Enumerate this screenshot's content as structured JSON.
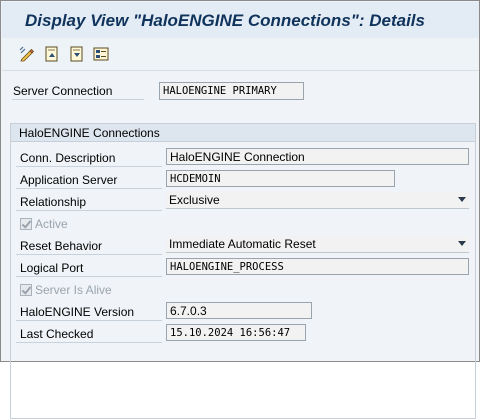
{
  "window": {
    "title": "Display View \"HaloENGINE Connections\": Details"
  },
  "toolbar": {
    "buttons": [
      {
        "icon": "display-change-icon"
      },
      {
        "icon": "previous-entry-icon"
      },
      {
        "icon": "next-entry-icon"
      },
      {
        "icon": "variable-list-icon"
      }
    ]
  },
  "server_connection": {
    "label": "Server Connection",
    "value": "HALOENGINE PRIMARY"
  },
  "group": {
    "title": "HaloENGINE Connections",
    "conn_description": {
      "label": "Conn. Description",
      "value": "HaloENGINE Connection"
    },
    "application_server": {
      "label": "Application Server",
      "value": "HCDEMOIN"
    },
    "relationship": {
      "label": "Relationship",
      "value": "Exclusive"
    },
    "active": {
      "label": "Active",
      "checked": true
    },
    "reset_behavior": {
      "label": "Reset Behavior",
      "value": "Immediate Automatic Reset"
    },
    "logical_port": {
      "label": "Logical Port",
      "value": "HALOENGINE_PROCESS"
    },
    "server_is_alive": {
      "label": "Server Is Alive",
      "checked": true
    },
    "haloengine_version": {
      "label": "HaloENGINE Version",
      "value": "6.7.0.3"
    },
    "last_checked": {
      "label": "Last Checked",
      "value": "15.10.2024 16:56:47"
    }
  },
  "colors": {
    "title": "#10335c",
    "background": "#eef3f8",
    "group_header": "#dde6ef"
  }
}
